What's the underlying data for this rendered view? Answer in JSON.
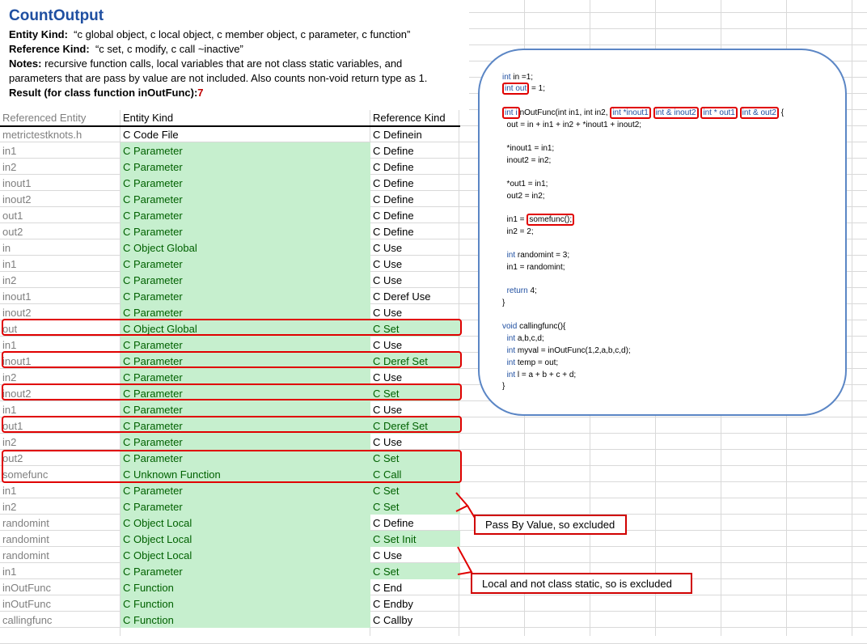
{
  "title": "CountOutput",
  "entity_kind_label": "Entity Kind:",
  "entity_kind_value": "“c global object, c local object, c member object, c parameter, c function”",
  "reference_kind_label": "Reference Kind:",
  "reference_kind_value": "“c set, c modify, c call ~inactive”",
  "notes_label": "Notes:",
  "notes_line1": "recursive function calls, local variables that are not class static variables, and",
  "notes_line2": "parameters that are pass by value are not included. Also counts non-void return type as 1.",
  "result_label": "Result  (for class function inOutFunc):",
  "result_value": "7",
  "table": {
    "headers": [
      "Referenced Entity",
      "Entity Kind",
      "Reference Kind"
    ],
    "rows": [
      [
        "metrictestknots.h",
        "C Code File",
        "C Definein"
      ],
      [
        "in1",
        "C Parameter",
        "C Define"
      ],
      [
        "in2",
        "C Parameter",
        "C Define"
      ],
      [
        "inout1",
        "C Parameter",
        "C Define"
      ],
      [
        "inout2",
        "C Parameter",
        "C Define"
      ],
      [
        "out1",
        "C Parameter",
        "C Define"
      ],
      [
        "out2",
        "C Parameter",
        "C Define"
      ],
      [
        "in",
        "C Object Global",
        "C Use"
      ],
      [
        "in1",
        "C Parameter",
        "C Use"
      ],
      [
        "in2",
        "C Parameter",
        "C Use"
      ],
      [
        "inout1",
        "C Parameter",
        "C Deref Use"
      ],
      [
        "inout2",
        "C Parameter",
        "C Use"
      ],
      [
        "out",
        "C Object Global",
        "C Set"
      ],
      [
        "in1",
        "C Parameter",
        "C Use"
      ],
      [
        "inout1",
        "C Parameter",
        "C Deref Set"
      ],
      [
        "in2",
        "C Parameter",
        "C Use"
      ],
      [
        "inout2",
        "C Parameter",
        "C Set"
      ],
      [
        "in1",
        "C Parameter",
        "C Use"
      ],
      [
        "out1",
        "C Parameter",
        "C Deref Set"
      ],
      [
        "in2",
        "C Parameter",
        "C Use"
      ],
      [
        "out2",
        "C Parameter",
        "C Set"
      ],
      [
        "somefunc",
        "C Unknown Function",
        "C Call"
      ],
      [
        "in1",
        "C Parameter",
        "C Set"
      ],
      [
        "in2",
        "C Parameter",
        "C Set"
      ],
      [
        "randomint",
        "C Object Local",
        "C Define"
      ],
      [
        "randomint",
        "C Object Local",
        "C Set Init"
      ],
      [
        "randomint",
        "C Object Local",
        "C Use"
      ],
      [
        "in1",
        "C Parameter",
        "C Set"
      ],
      [
        "inOutFunc",
        "C Function",
        "C End"
      ],
      [
        "inOutFunc",
        "C Function",
        "C Endby"
      ],
      [
        "callingfunc",
        "C Function",
        "C Callby"
      ]
    ],
    "green_kind_rows": [
      1,
      2,
      3,
      4,
      5,
      6,
      7,
      8,
      9,
      10,
      11,
      12,
      13,
      14,
      15,
      16,
      17,
      18,
      19,
      20,
      21,
      22,
      23,
      24,
      25,
      26,
      27,
      28,
      29,
      30
    ],
    "green_ref_rows": [
      12,
      14,
      16,
      18,
      20,
      21,
      22,
      23,
      25,
      27
    ]
  },
  "code": {
    "l1_kw": "int",
    "l1": " in =1;",
    "l2_box": "int out",
    "l2": " = 1;",
    "l3_box1": "int i",
    "l3_a": "nOutFunc(int in1, int in2, ",
    "l3_box2": "int *inout1",
    "l3_box3": "int & inout2",
    "l3_box4": "int * out1",
    "l3_box5": "int & out2",
    "l3_end": " {",
    "l4": "  out = in + in1 + in2 + *inout1 + inout2;",
    "l5": "  *inout1 = in1;",
    "l6": "  inout2 = in2;",
    "l7": "  *out1 = in1;",
    "l8": "  out2 = in2;",
    "l9_a": "  in1 = ",
    "l9_box": "somefunc();",
    "l10": "  in2 = 2;",
    "l11_kw": "int",
    "l11": " randomint = 3;",
    "l12": "  in1 = randomint;",
    "l13_kw": "return",
    "l13": " 4;",
    "l14": "}",
    "l15_kw": "void",
    "l15": " callingfunc(){",
    "l16_kw": "int",
    "l16": " a,b,c,d;",
    "l17_kw": "int",
    "l17": " myval = inOutFunc(1,2,a,b,c,d);",
    "l18_kw": "int",
    "l18": " temp = out;",
    "l19_kw": "int",
    "l19": " l = a + b + c + d;",
    "l20": "}"
  },
  "callouts": {
    "pass_by_value": "Pass By Value, so excluded",
    "local_static": "Local and not class static, so is excluded"
  },
  "colors": {
    "title": "#1f4fa1",
    "highlight_green": "#c6efce",
    "green_text": "#006100",
    "red_box": "#e00000",
    "panel_border": "#5b86c5"
  }
}
